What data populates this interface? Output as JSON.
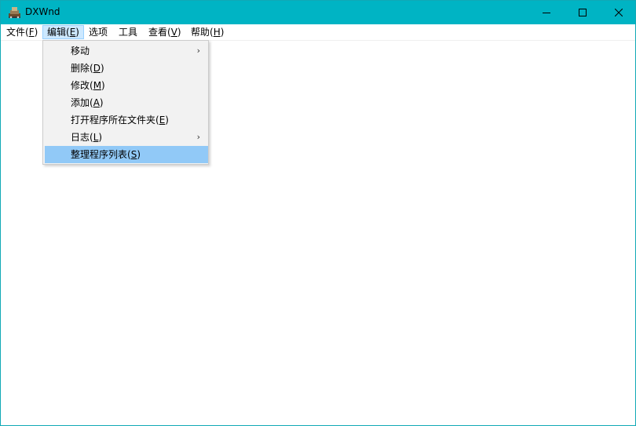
{
  "window": {
    "title": "DXWnd",
    "app_icon": "dxwnd-app-icon",
    "controls": {
      "minimize_icon": "minimize-icon",
      "maximize_icon": "maximize-icon",
      "close_icon": "close-icon"
    },
    "accent_color": "#00b4c4"
  },
  "menubar": {
    "items": [
      {
        "label": "文件(",
        "key": "F",
        "suffix": ")"
      },
      {
        "label": "编辑(",
        "key": "E",
        "suffix": ")"
      },
      {
        "label": "选项",
        "key": "",
        "suffix": ""
      },
      {
        "label": "工具",
        "key": "",
        "suffix": ""
      },
      {
        "label": "查看(",
        "key": "V",
        "suffix": ")"
      },
      {
        "label": "帮助(",
        "key": "H",
        "suffix": ")"
      }
    ],
    "active_index": 1
  },
  "edit_menu": {
    "items": [
      {
        "label": "移动",
        "key": "",
        "suffix": "",
        "submenu": true
      },
      {
        "label": "删除(",
        "key": "D",
        "suffix": ")",
        "submenu": false
      },
      {
        "label": "修改(",
        "key": "M",
        "suffix": ")",
        "submenu": false
      },
      {
        "label": "添加(",
        "key": "A",
        "suffix": ")",
        "submenu": false
      },
      {
        "label": "打开程序所在文件夹(",
        "key": "E",
        "suffix": ")",
        "submenu": false
      },
      {
        "label": "日志(",
        "key": "L",
        "suffix": ")",
        "submenu": true
      },
      {
        "label": "整理程序列表(",
        "key": "S",
        "suffix": ")",
        "submenu": false
      }
    ],
    "highlighted_index": 6,
    "submenu_arrow": "›",
    "highlight_color": "#91c9f7"
  }
}
